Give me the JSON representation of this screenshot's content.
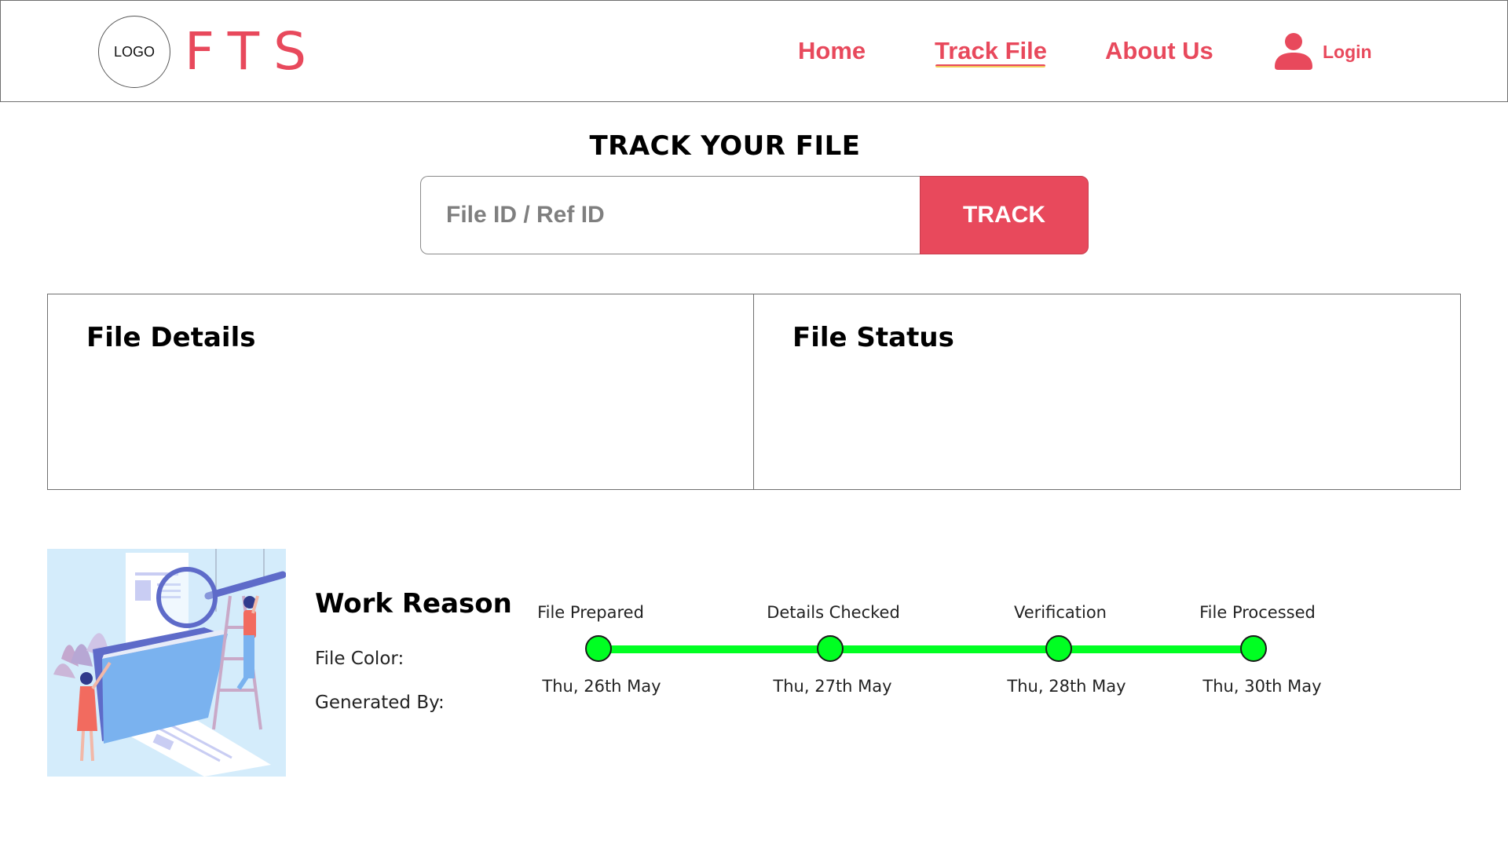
{
  "header": {
    "logo_text": "LOGO",
    "brand": "FTS",
    "nav": {
      "home": "Home",
      "track_file": "Track File",
      "about_us": "About Us",
      "login": "Login"
    },
    "active_nav": "track_file",
    "user_icon": "user-icon"
  },
  "tracker": {
    "title": "TRACK YOUR FILE",
    "input_placeholder": "File ID / Ref ID",
    "input_value": "",
    "button_label": "TRACK"
  },
  "panels": {
    "details_title": "File Details",
    "status_title": "File Status"
  },
  "work": {
    "title": "Work Reason",
    "file_color_label": "File Color:",
    "generated_by_label": "Generated By:",
    "illustration": "file-search-illustration"
  },
  "timeline": {
    "steps": [
      {
        "label": "File Prepared",
        "date": "Thu, 26th May",
        "done": true
      },
      {
        "label": "Details Checked",
        "date": "Thu, 27th May",
        "done": true
      },
      {
        "label": "Verification",
        "date": "Thu, 28th May",
        "done": true
      },
      {
        "label": "File Processed",
        "date": "Thu, 30th May",
        "done": true
      }
    ]
  },
  "colors": {
    "accent": "#e8495c",
    "underline_highlight": "#f3cf5a",
    "timeline_green": "#00ff22",
    "illustration_bg": "#d4ecfb"
  }
}
